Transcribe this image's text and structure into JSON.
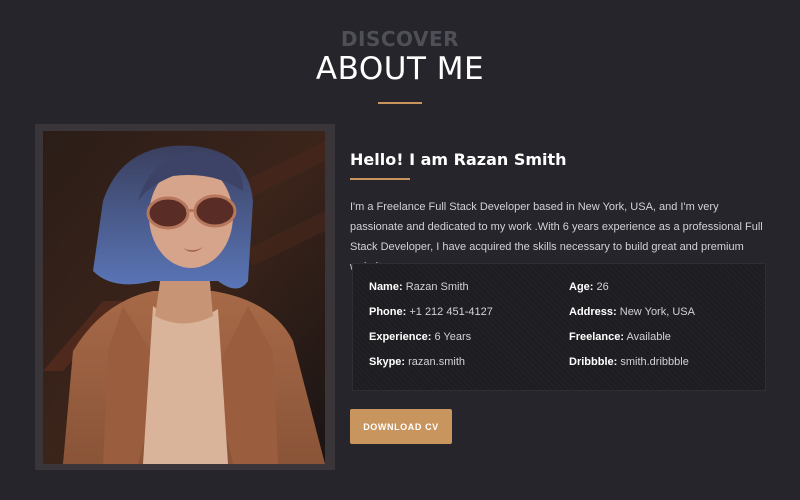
{
  "heading": {
    "kicker": "DISCOVER",
    "title": "ABOUT ME"
  },
  "photo": {
    "icon": "portrait-photo"
  },
  "bio": {
    "title": "Hello! I am Razan Smith",
    "text": "I'm a Freelance Full Stack Developer based in New York, USA, and I'm very passionate and dedicated to my work .With 6 years experience as a professional Full Stack Developer, I have acquired the skills necessary to build great and premium websites."
  },
  "info": {
    "name_label": "Name:",
    "name_value": "Razan Smith",
    "age_label": "Age:",
    "age_value": "26",
    "phone_label": "Phone:",
    "phone_value": "+1 212 451-4127",
    "address_label": "Address:",
    "address_value": "New York, USA",
    "experience_label": "Experience:",
    "experience_value": "6 Years",
    "freelance_label": "Freelance:",
    "freelance_value": "Available",
    "skype_label": "Skype:",
    "skype_value": "razan.smith",
    "dribbble_label": "Dribbble:",
    "dribbble_value": "smith.dribbble"
  },
  "cta": {
    "download_label": "DOWNLOAD CV"
  },
  "colors": {
    "background": "#25252b",
    "accent": "#c8955f",
    "muted_heading": "#4f4f57"
  }
}
